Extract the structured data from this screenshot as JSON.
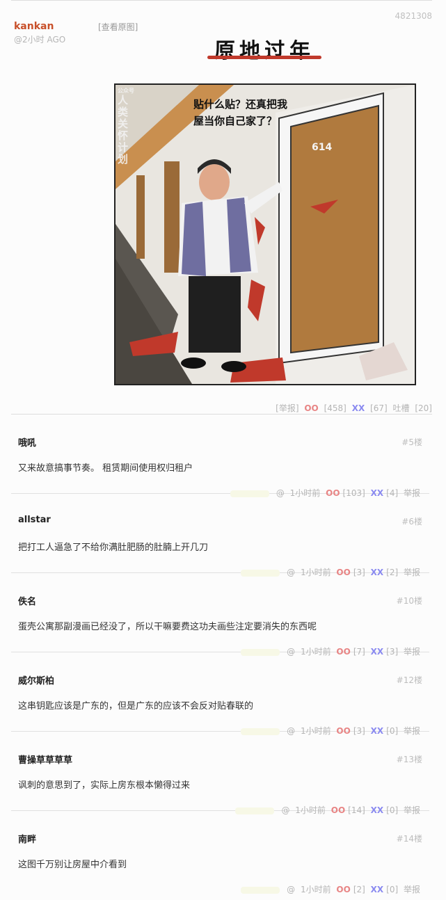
{
  "post": {
    "author": "kankan",
    "time": "@2小时 AGO",
    "view_original": "[查看原图]",
    "id": "4821308",
    "comic_title": "原地过年",
    "speech_bubble": "贴什么贴？还真把我屋当你自己家了？",
    "door_number": "614",
    "watermark_small": "公众号",
    "watermark": "人类关怀计划",
    "report": "[举报]",
    "oo_icon": "OO",
    "oo_count": "[458]",
    "xx_icon": "XX",
    "xx_count": "[67]",
    "tucao": "吐槽",
    "tucao_count": "[20]"
  },
  "comments": [
    {
      "name": "哦吼",
      "floor": "#5楼",
      "body": "又来故意搞事节奏。 租赁期间使用权归租户",
      "at": "@",
      "time": "1小时前",
      "oo": "[103]",
      "xx": "[4]",
      "report": "举报"
    },
    {
      "name": "allstar",
      "floor": "#6楼",
      "body": "把打工人逼急了不给你满肚肥肠的肚腩上开几刀",
      "at": "@",
      "time": "1小时前",
      "oo": "[3]",
      "xx": "[2]",
      "report": "举报"
    },
    {
      "name": "佚名",
      "floor": "#10楼",
      "body": "蛋壳公寓那副漫画已经没了，所以干嘛要费这功夫画些注定要消失的东西呢",
      "at": "@",
      "time": "1小时前",
      "oo": "[7]",
      "xx": "[3]",
      "report": "举报"
    },
    {
      "name": "威尔斯柏",
      "floor": "#12楼",
      "body": "这串钥匙应该是广东的，但是广东的应该不会反对贴春联的",
      "at": "@",
      "time": "1小时前",
      "oo": "[3]",
      "xx": "[0]",
      "report": "举报"
    },
    {
      "name": "曹操草草草草",
      "floor": "#13楼",
      "body": "讽刺的意思到了，实际上房东根本懒得过来",
      "at": "@",
      "time": "1小时前",
      "oo": "[14]",
      "xx": "[0]",
      "report": "举报"
    },
    {
      "name": "南畔",
      "floor": "#14楼",
      "body": "这图千万别让房屋中介看到",
      "at": "@",
      "time": "1小时前",
      "oo": "[2]",
      "xx": "[0]",
      "report": "举报"
    }
  ],
  "labels": {
    "oo": "OO",
    "xx": "XX"
  },
  "colors": {
    "author": "#c8502a",
    "oo": "#e88585",
    "xx": "#8a8af0",
    "muted": "#b5b5b5"
  }
}
